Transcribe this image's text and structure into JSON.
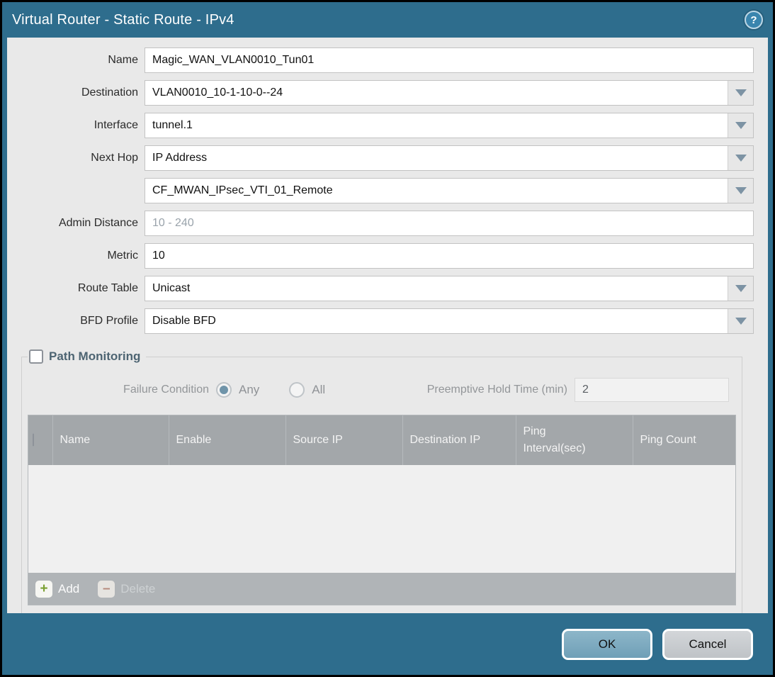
{
  "window": {
    "title": "Virtual Router - Static Route - IPv4",
    "help_icon_glyph": "?",
    "colors": {
      "frame_teal": "#2e6d8d",
      "content_bg": "#e9e9e9",
      "table_header_bg": "#a3a7aa",
      "ok_button_bg": "#7babc0",
      "cancel_button_bg": "#c9cdd1",
      "add_plus_green": "#7ba032",
      "delete_minus_red": "#b5897b",
      "radio_selected_fill": "#6f94a9"
    }
  },
  "form": {
    "fields": [
      {
        "label": "Name",
        "value": "Magic_WAN_VLAN0010_Tun01",
        "type": "text"
      },
      {
        "label": "Destination",
        "value": "VLAN0010_10-1-10-0--24",
        "type": "dropdown"
      },
      {
        "label": "Interface",
        "value": "tunnel.1",
        "type": "dropdown"
      },
      {
        "label": "Next Hop",
        "value": "IP Address",
        "type": "dropdown"
      },
      {
        "label": "",
        "value": "CF_MWAN_IPsec_VTI_01_Remote",
        "type": "dropdown"
      },
      {
        "label": "Admin Distance",
        "value": "",
        "placeholder": "10 - 240",
        "type": "text"
      },
      {
        "label": "Metric",
        "value": "10",
        "type": "text"
      },
      {
        "label": "Route Table",
        "value": "Unicast",
        "type": "dropdown"
      },
      {
        "label": "BFD Profile",
        "value": "Disable BFD",
        "type": "dropdown"
      }
    ]
  },
  "path_monitoring": {
    "legend": "Path Monitoring",
    "checkbox_checked": false,
    "failure_condition_label": "Failure Condition",
    "radio_any_label": "Any",
    "radio_all_label": "All",
    "any_selected": true,
    "all_selected": false,
    "preemptive_label": "Preemptive Hold Time (min)",
    "preemptive_value": "2",
    "table": {
      "columns": [
        "Name",
        "Enable",
        "Source IP",
        "Destination IP",
        "Ping Interval(sec)",
        "Ping Count"
      ],
      "rows": [],
      "add_label": "Add",
      "delete_label": "Delete",
      "delete_disabled": true
    }
  },
  "footer": {
    "ok_label": "OK",
    "cancel_label": "Cancel"
  }
}
